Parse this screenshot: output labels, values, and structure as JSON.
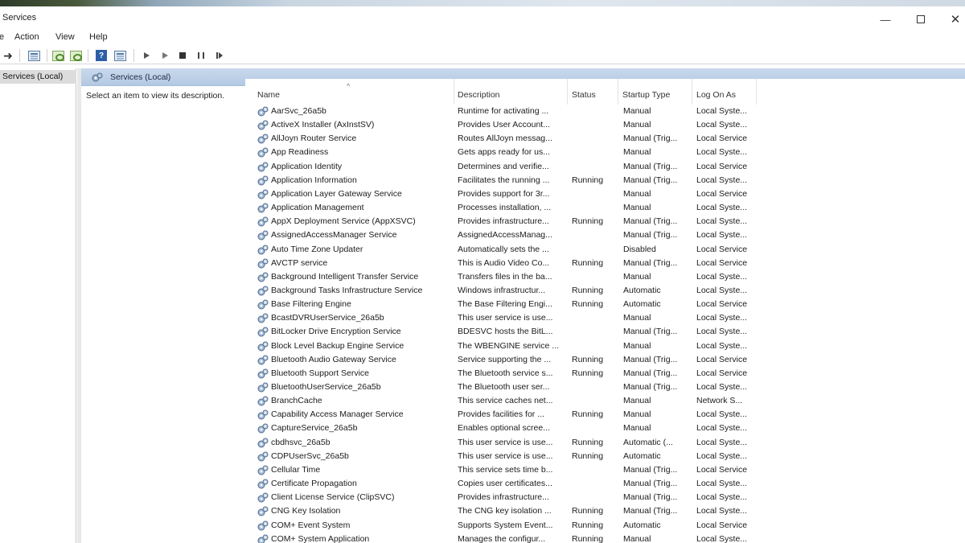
{
  "window": {
    "title": "Services"
  },
  "menu": [
    "Action",
    "View",
    "Help"
  ],
  "tree": {
    "root_label": "Services (Local)"
  },
  "content": {
    "header_title": "Services (Local)",
    "description_prompt": "Select an item to view its description."
  },
  "columns": [
    "Name",
    "Description",
    "Status",
    "Startup Type",
    "Log On As"
  ],
  "services": [
    {
      "name": "AarSvc_26a5b",
      "description": "Runtime for activating ...",
      "status": "",
      "startup": "Manual",
      "logon": "Local Syste..."
    },
    {
      "name": "ActiveX Installer (AxInstSV)",
      "description": "Provides User Account...",
      "status": "",
      "startup": "Manual",
      "logon": "Local Syste..."
    },
    {
      "name": "AllJoyn Router Service",
      "description": "Routes AllJoyn messag...",
      "status": "",
      "startup": "Manual (Trig...",
      "logon": "Local Service"
    },
    {
      "name": "App Readiness",
      "description": "Gets apps ready for us...",
      "status": "",
      "startup": "Manual",
      "logon": "Local Syste..."
    },
    {
      "name": "Application Identity",
      "description": "Determines and verifie...",
      "status": "",
      "startup": "Manual (Trig...",
      "logon": "Local Service"
    },
    {
      "name": "Application Information",
      "description": "Facilitates the running ...",
      "status": "Running",
      "startup": "Manual (Trig...",
      "logon": "Local Syste..."
    },
    {
      "name": "Application Layer Gateway Service",
      "description": "Provides support for 3r...",
      "status": "",
      "startup": "Manual",
      "logon": "Local Service"
    },
    {
      "name": "Application Management",
      "description": "Processes installation, ...",
      "status": "",
      "startup": "Manual",
      "logon": "Local Syste..."
    },
    {
      "name": "AppX Deployment Service (AppXSVC)",
      "description": "Provides infrastructure...",
      "status": "Running",
      "startup": "Manual (Trig...",
      "logon": "Local Syste..."
    },
    {
      "name": "AssignedAccessManager Service",
      "description": "AssignedAccessManag...",
      "status": "",
      "startup": "Manual (Trig...",
      "logon": "Local Syste..."
    },
    {
      "name": "Auto Time Zone Updater",
      "description": "Automatically sets the ...",
      "status": "",
      "startup": "Disabled",
      "logon": "Local Service"
    },
    {
      "name": "AVCTP service",
      "description": "This is Audio Video Co...",
      "status": "Running",
      "startup": "Manual (Trig...",
      "logon": "Local Service"
    },
    {
      "name": "Background Intelligent Transfer Service",
      "description": "Transfers files in the ba...",
      "status": "",
      "startup": "Manual",
      "logon": "Local Syste..."
    },
    {
      "name": "Background Tasks Infrastructure Service",
      "description": "Windows infrastructur...",
      "status": "Running",
      "startup": "Automatic",
      "logon": "Local Syste..."
    },
    {
      "name": "Base Filtering Engine",
      "description": "The Base Filtering Engi...",
      "status": "Running",
      "startup": "Automatic",
      "logon": "Local Service"
    },
    {
      "name": "BcastDVRUserService_26a5b",
      "description": "This user service is use...",
      "status": "",
      "startup": "Manual",
      "logon": "Local Syste..."
    },
    {
      "name": "BitLocker Drive Encryption Service",
      "description": "BDESVC hosts the BitL...",
      "status": "",
      "startup": "Manual (Trig...",
      "logon": "Local Syste..."
    },
    {
      "name": "Block Level Backup Engine Service",
      "description": "The WBENGINE service ...",
      "status": "",
      "startup": "Manual",
      "logon": "Local Syste..."
    },
    {
      "name": "Bluetooth Audio Gateway Service",
      "description": "Service supporting the ...",
      "status": "Running",
      "startup": "Manual (Trig...",
      "logon": "Local Service"
    },
    {
      "name": "Bluetooth Support Service",
      "description": "The Bluetooth service s...",
      "status": "Running",
      "startup": "Manual (Trig...",
      "logon": "Local Service"
    },
    {
      "name": "BluetoothUserService_26a5b",
      "description": "The Bluetooth user ser...",
      "status": "",
      "startup": "Manual (Trig...",
      "logon": "Local Syste..."
    },
    {
      "name": "BranchCache",
      "description": "This service caches net...",
      "status": "",
      "startup": "Manual",
      "logon": "Network S..."
    },
    {
      "name": "Capability Access Manager Service",
      "description": "Provides facilities for ...",
      "status": "Running",
      "startup": "Manual",
      "logon": "Local Syste..."
    },
    {
      "name": "CaptureService_26a5b",
      "description": "Enables optional scree...",
      "status": "",
      "startup": "Manual",
      "logon": "Local Syste..."
    },
    {
      "name": "cbdhsvc_26a5b",
      "description": "This user service is use...",
      "status": "Running",
      "startup": "Automatic (...",
      "logon": "Local Syste..."
    },
    {
      "name": "CDPUserSvc_26a5b",
      "description": "This user service is use...",
      "status": "Running",
      "startup": "Automatic",
      "logon": "Local Syste..."
    },
    {
      "name": "Cellular Time",
      "description": "This service sets time b...",
      "status": "",
      "startup": "Manual (Trig...",
      "logon": "Local Service"
    },
    {
      "name": "Certificate Propagation",
      "description": "Copies user certificates...",
      "status": "",
      "startup": "Manual (Trig...",
      "logon": "Local Syste..."
    },
    {
      "name": "Client License Service (ClipSVC)",
      "description": "Provides infrastructure...",
      "status": "",
      "startup": "Manual (Trig...",
      "logon": "Local Syste..."
    },
    {
      "name": "CNG Key Isolation",
      "description": "The CNG key isolation ...",
      "status": "Running",
      "startup": "Manual (Trig...",
      "logon": "Local Syste..."
    },
    {
      "name": "COM+ Event System",
      "description": "Supports System Event...",
      "status": "Running",
      "startup": "Automatic",
      "logon": "Local Service"
    },
    {
      "name": "COM+ System Application",
      "description": "Manages the configur...",
      "status": "Running",
      "startup": "Manual",
      "logon": "Local Syste..."
    }
  ]
}
